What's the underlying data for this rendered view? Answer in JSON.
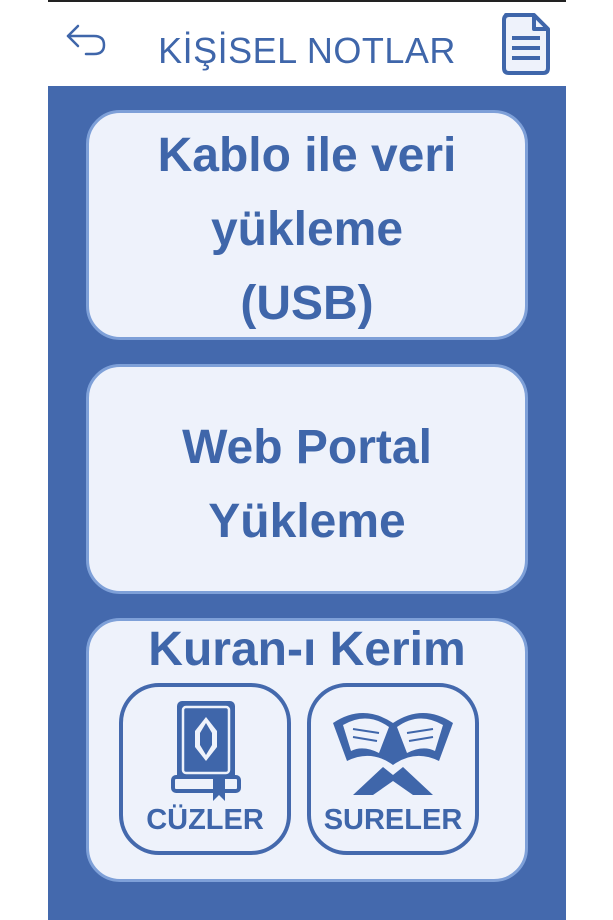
{
  "header": {
    "title": "KİŞİSEL NOTLAR",
    "back_icon": "back-arrow-icon",
    "right_icon": "document-icon"
  },
  "cards": {
    "usb": {
      "line1": "Kablo ile veri",
      "line2": "yükleme",
      "line3": "(USB)"
    },
    "web": {
      "line1": "Web Portal",
      "line2": "Yükleme"
    },
    "quran": {
      "title": "Kuran-ı Kerim",
      "cuzler_label": "CÜZLER",
      "sureler_label": "SURELER"
    }
  },
  "colors": {
    "accent": "#4469ad",
    "text_blue": "#3f66aa",
    "card_bg": "#eef2fb",
    "card_border": "#7ea0d8"
  }
}
